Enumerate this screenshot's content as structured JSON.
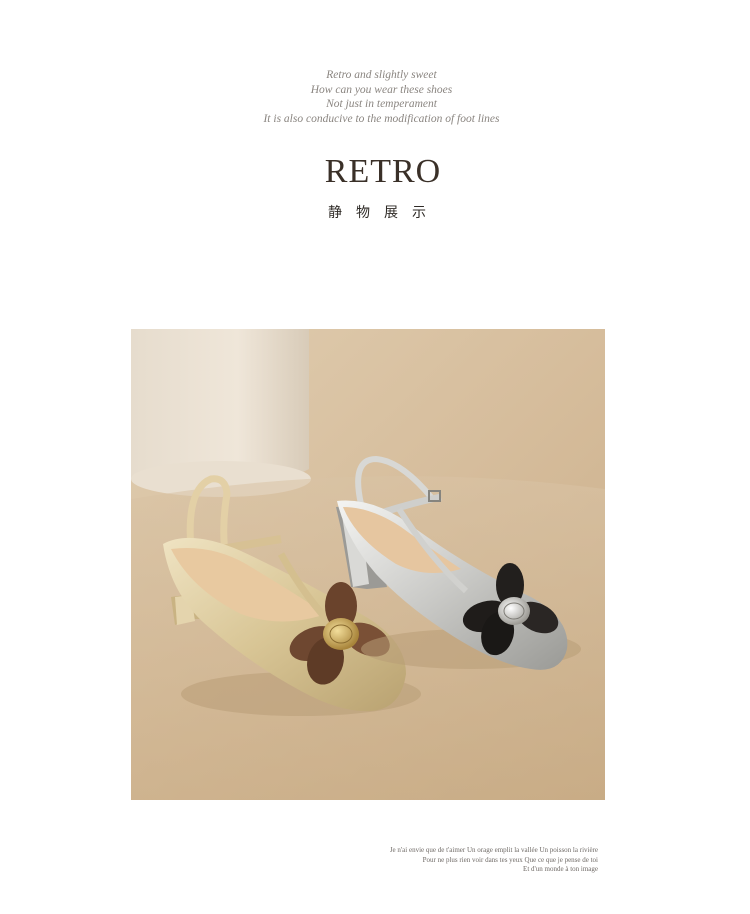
{
  "intro_lines": [
    "Retro and slightly sweet",
    "How can you wear these shoes",
    "Not just in temperament",
    "It is also conducive to the modification of foot lines"
  ],
  "brand": "RETRO",
  "subtitle": "静物展示",
  "photo": {
    "alt": "Two T-strap block-heel sandals, gold and silver, with brown and black flower ornaments"
  },
  "french_lines": [
    "Je n'ai envie que de t'aimer Un orage emplit la vallée Un poisson la rivière",
    "Pour ne plus rien voir dans tes yeux Que ce que je pense de toi",
    "Et d'un monde à ton image"
  ],
  "colors": {
    "background": "#ffffff",
    "photo_bg": "#d7c0a0",
    "brand_text": "#3a3028"
  }
}
